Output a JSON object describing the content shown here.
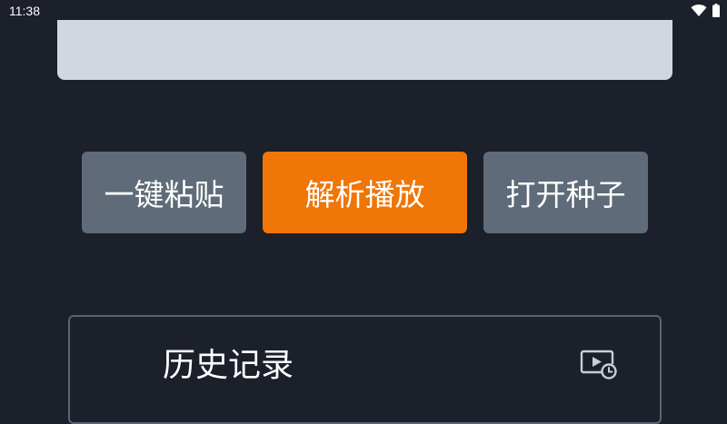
{
  "status_bar": {
    "time": "11:38",
    "icons": [
      "wifi-icon",
      "battery-icon"
    ]
  },
  "url_input": {
    "value": "",
    "placeholder": ""
  },
  "buttons": {
    "paste_label": "一键粘贴",
    "parse_label": "解析播放",
    "torrent_label": "打开种子"
  },
  "history": {
    "title": "历史记录",
    "icon": "history-video-icon"
  },
  "colors": {
    "background": "#1b202a",
    "input_background": "#d1d7e0",
    "accent": "#f07608",
    "secondary_button": "#5f6b78",
    "card_border": "#5b6370"
  }
}
